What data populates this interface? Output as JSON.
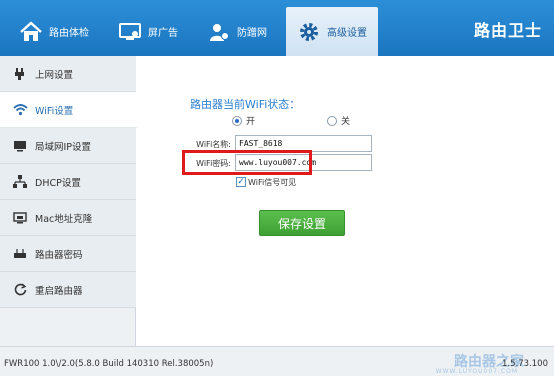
{
  "header": {
    "tabs": [
      {
        "label": "路由体检",
        "icon": "home-icon"
      },
      {
        "label": "屏广告",
        "icon": "screen-ad-icon"
      },
      {
        "label": "防蹭网",
        "icon": "user-shield-icon"
      },
      {
        "label": "高级设置",
        "icon": "gear-icon",
        "active": true
      }
    ],
    "brand": "路由卫士"
  },
  "sidebar": {
    "items": [
      {
        "label": "上网设置",
        "icon": "plug-icon"
      },
      {
        "label": "WiFi设置",
        "icon": "wifi-icon",
        "active": true
      },
      {
        "label": "局域网IP设置",
        "icon": "monitor-icon"
      },
      {
        "label": "DHCP设置",
        "icon": "network-icon"
      },
      {
        "label": "Mac地址克隆",
        "icon": "screen-icon"
      },
      {
        "label": "路由器密码",
        "icon": "router-icon"
      },
      {
        "label": "重启路由器",
        "icon": "restart-icon"
      }
    ]
  },
  "main": {
    "status_title": "路由器当前WiFi状态：",
    "radio_on": "开",
    "radio_off": "关",
    "wifi_name_label": "WiFi名称:",
    "wifi_name_value": "FAST_8618",
    "wifi_password_label": "WiFi密码:",
    "wifi_password_value": "www.luyou007.com",
    "show_password_label": "WiFi信号可见",
    "save_button": "保存设置"
  },
  "footer": {
    "version": "FWR100 1.0\\/2.0(5.8.0 Build 140310 Rel.38005n)",
    "version_right": "1.5.73.100",
    "watermark": "路由器之家",
    "watermark_sub": "WWW.LUYOU007.COM"
  },
  "colors": {
    "header_blue": "#1e7ac4",
    "highlight_red": "#e01a1a",
    "save_green": "#4cb040",
    "title_blue": "#2b7fd0"
  }
}
